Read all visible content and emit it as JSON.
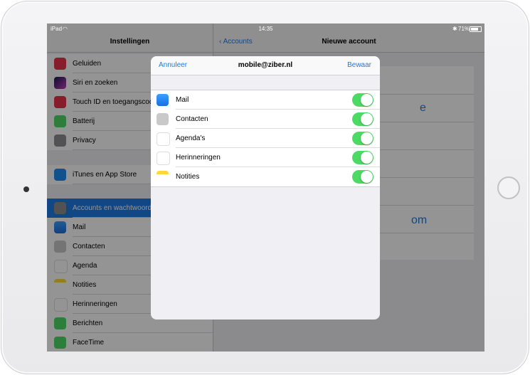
{
  "status": {
    "device": "iPad",
    "time": "14:35",
    "battery": "71%"
  },
  "settings": {
    "title": "Instellingen",
    "items": [
      {
        "label": "Geluiden",
        "icon": "speaker-icon",
        "color": "#e8334b"
      },
      {
        "label": "Siri en zoeken",
        "icon": "siri-icon",
        "color": "#2b2b6b"
      },
      {
        "label": "Touch ID en toegangscode",
        "icon": "fingerprint-icon",
        "color": "#e8334b"
      },
      {
        "label": "Batterij",
        "icon": "battery-icon",
        "color": "#4cd964"
      },
      {
        "label": "Privacy",
        "icon": "hand-icon",
        "color": "#8e8e93"
      },
      {
        "label": "iTunes en App Store",
        "icon": "app-store-icon",
        "color": "#1f8ef1"
      },
      {
        "label": "Accounts en wachtwoorden",
        "icon": "key-icon",
        "color": "#8e8e93"
      },
      {
        "label": "Mail",
        "icon": "mail-icon",
        "color": "#1f8ef1"
      },
      {
        "label": "Contacten",
        "icon": "contacts-icon",
        "color": "#b8b8b8"
      },
      {
        "label": "Agenda",
        "icon": "calendar-icon",
        "color": "#ffffff"
      },
      {
        "label": "Notities",
        "icon": "notes-icon",
        "color": "#ffcc00"
      },
      {
        "label": "Herinneringen",
        "icon": "reminders-icon",
        "color": "#ffffff"
      },
      {
        "label": "Berichten",
        "icon": "messages-icon",
        "color": "#4cd964"
      },
      {
        "label": "FaceTime",
        "icon": "facetime-icon",
        "color": "#4cd964"
      }
    ]
  },
  "right": {
    "back_label": "Accounts",
    "title": "Nieuwe account",
    "ghost_1": "e",
    "ghost_2": "om"
  },
  "modal": {
    "cancel_label": "Annuleer",
    "title": "mobile@ziber.nl",
    "save_label": "Bewaar",
    "rows": [
      {
        "label": "Mail",
        "icon": "mail-icon",
        "on": true
      },
      {
        "label": "Contacten",
        "icon": "contacts-icon",
        "on": true
      },
      {
        "label": "Agenda's",
        "icon": "calendar-icon",
        "on": true
      },
      {
        "label": "Herinneringen",
        "icon": "reminders-icon",
        "on": true
      },
      {
        "label": "Notities",
        "icon": "notes-icon",
        "on": true
      }
    ]
  },
  "colors": {
    "accent": "#1f7ae6",
    "toggle_on": "#4cd964"
  }
}
